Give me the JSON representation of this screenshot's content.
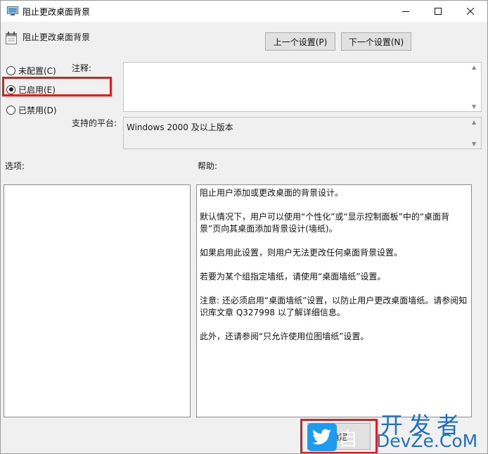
{
  "window": {
    "title": "阻止更改桌面背景"
  },
  "header": {
    "policy_name": "阻止更改桌面背景",
    "prev_label": "上一个设置(P)",
    "next_label": "下一个设置(N)"
  },
  "state": {
    "options": [
      {
        "label": "未配置(C)",
        "checked": false
      },
      {
        "label": "已启用(E)",
        "checked": true
      },
      {
        "label": "已禁用(D)",
        "checked": false
      }
    ]
  },
  "fields": {
    "comment_label": "注释:",
    "comment_value": "",
    "platform_label": "支持的平台:",
    "platform_value": "Windows 2000 及以上版本"
  },
  "sections": {
    "options_label": "选项:",
    "help_label": "帮助:"
  },
  "help": {
    "paragraphs": [
      "阻止用户添加或更改桌面的背景设计。",
      "默认情况下，用户可以使用“个性化”或“显示控制面板”中的“桌面背景”页向其桌面添加背景设计(墙纸)。",
      "如果启用此设置，则用户无法更改任何桌面背景设置。",
      "若要为某个组指定墙纸，请使用“桌面墙纸”设置。",
      "注意: 还必须启用“桌面墙纸”设置，以防止用户更改桌面墙纸。请参阅知识库文章 Q327998 以了解详细信息。",
      "此外，还请参阅“只允许使用位图墙纸”设置。"
    ]
  },
  "footer": {
    "ok_label": "确定"
  },
  "watermark": {
    "line1": "开发者",
    "line2": "DevZe.CoM",
    "overlay": "自"
  },
  "colors": {
    "highlight": "#e01e1e",
    "watermark": "#1f6fc6",
    "bird": "#1d9bf0"
  },
  "icons": [
    "window-app-icon",
    "minimize-icon",
    "maximize-icon",
    "close-icon",
    "policy-icon",
    "bird-logo-icon"
  ]
}
